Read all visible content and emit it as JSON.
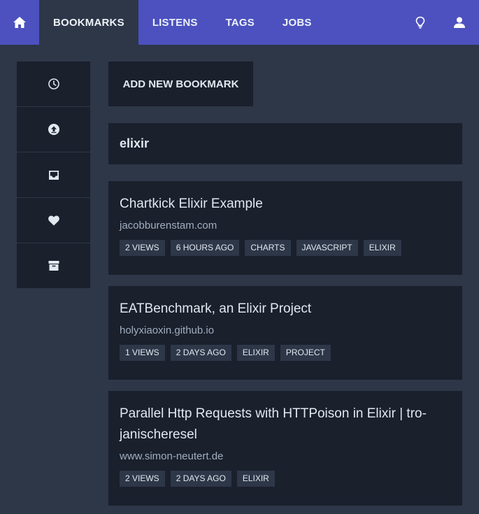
{
  "nav": {
    "items": [
      {
        "label": "BOOKMARKS",
        "active": true
      },
      {
        "label": "LISTENS",
        "active": false
      },
      {
        "label": "TAGS",
        "active": false
      },
      {
        "label": "JOBS",
        "active": false
      }
    ]
  },
  "icons": {
    "home": "home-icon",
    "theme": "lightbulb-icon",
    "user": "user-icon",
    "sidebar": [
      "clock-icon",
      "upload-icon",
      "inbox-icon",
      "heart-icon",
      "archive-icon"
    ]
  },
  "colors": {
    "accent": "#4c51bf",
    "background": "#2d3748",
    "panel": "#1a202c"
  },
  "actions": {
    "add_label": "ADD NEW BOOKMARK"
  },
  "search": {
    "value": "elixir"
  },
  "bookmarks": [
    {
      "title": "Chartkick Elixir Example",
      "domain": "jacobburenstam.com",
      "tags": [
        "2 VIEWS",
        "6 HOURS AGO",
        "CHARTS",
        "JAVASCRIPT",
        "ELIXIR"
      ]
    },
    {
      "title": "EATBenchmark, an Elixir Project",
      "domain": "holyxiaoxin.github.io",
      "tags": [
        "1 VIEWS",
        "2 DAYS AGO",
        "ELIXIR",
        "PROJECT"
      ]
    },
    {
      "title": "Parallel Http Requests with HTTPoison in Elixir | tro-janischeresel",
      "domain": "www.simon-neutert.de",
      "tags": [
        "2 VIEWS",
        "2 DAYS AGO",
        "ELIXIR"
      ]
    }
  ]
}
